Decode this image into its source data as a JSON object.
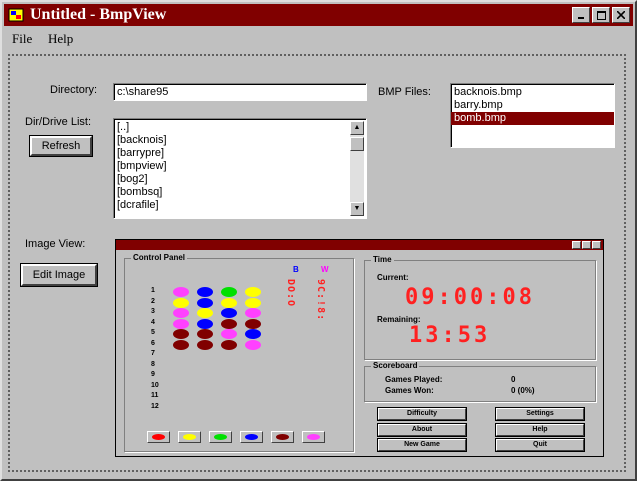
{
  "window": {
    "title": "Untitled - BmpView"
  },
  "menu": {
    "file": "File",
    "help": "Help"
  },
  "directory": {
    "label": "Directory:",
    "value": "c:\\share95"
  },
  "dir_list": {
    "label": "Dir/Drive List:",
    "items": [
      "[..]",
      "[backnois]",
      "[barrypre]",
      "[bmpview]",
      "[bog2]",
      "[bombsq]",
      "[dcrafile]"
    ]
  },
  "refresh_label": "Refresh",
  "bmp_files": {
    "label": "BMP Files:",
    "items": [
      "backnois.bmp",
      "barry.bmp",
      "bomb.bmp"
    ],
    "selected_index": 2
  },
  "image_view_label": "Image View:",
  "edit_image_label": "Edit Image",
  "preview": {
    "control_panel_title": "Control Panel",
    "row_numbers": [
      "1",
      "2",
      "3",
      "4",
      "5",
      "6",
      "7",
      "8",
      "9",
      "10",
      "11",
      "12"
    ],
    "col_headers": [
      "B",
      "W"
    ],
    "vertical_texts": [
      "DO:O",
      "9C:!8:"
    ],
    "peg_colors": [
      [
        "#ff40ff",
        "#0000ff",
        "#00e000",
        "#ffff00"
      ],
      [
        "#ffff00",
        "#0000ff",
        "#ffff00",
        "#ffff00"
      ],
      [
        "#ff40ff",
        "#ffff00",
        "#0000ff",
        "#ff40ff"
      ],
      [
        "#ff40ff",
        "#0000ff",
        "#800000",
        "#800000"
      ],
      [
        "#800000",
        "#800000",
        "#ff40ff",
        "#0000ff"
      ],
      [
        "#800000",
        "#800000",
        "#800000",
        "#ff40ff"
      ]
    ],
    "palette": [
      "#ff0000",
      "#ffff00",
      "#00e000",
      "#0000ff",
      "#800000",
      "#ff40ff"
    ],
    "time_title": "Time",
    "current_label": "Current:",
    "current_value": "09:00:08",
    "remaining_label": "Remaining:",
    "remaining_value": "13:53",
    "scoreboard_title": "Scoreboard",
    "games_played_label": "Games Played:",
    "games_played_value": "0",
    "games_won_label": "Games Won:",
    "games_won_value": "0 (0%)",
    "buttons": {
      "difficulty": "Difficulty",
      "settings": "Settings",
      "about": "About",
      "help": "Help",
      "new_game": "New Game",
      "quit": "Quit"
    }
  }
}
